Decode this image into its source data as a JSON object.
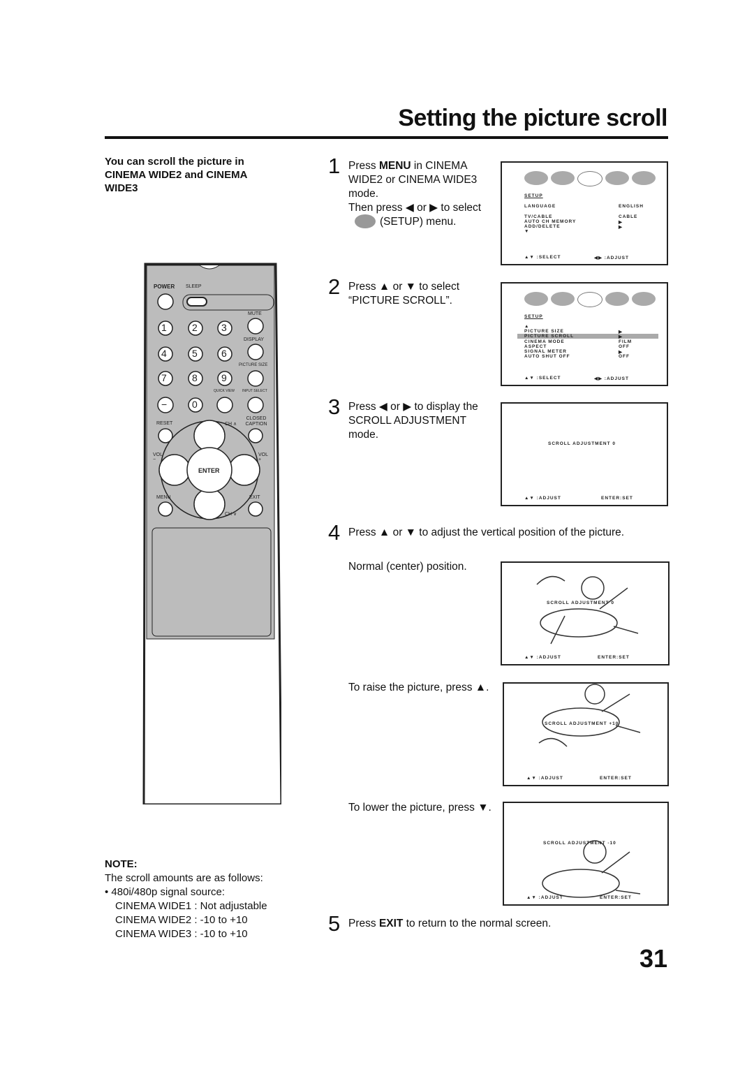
{
  "title": "Setting the picture scroll",
  "intro": "You can scroll the picture in CINEMA WIDE2 and CINEMA WIDE3",
  "steps": [
    {
      "num": "1",
      "text_pre": "Press ",
      "bold": "MENU",
      "text_post": " in CINEMA WIDE2 or CINEMA WIDE3 mode.",
      "line2": "Then press ◀ or ▶ to select",
      "line3": "(SETUP) menu."
    },
    {
      "num": "2",
      "text": "Press ▲ or ▼ to select “PICTURE SCROLL”."
    },
    {
      "num": "3",
      "text": "Press ◀ or ▶ to display the SCROLL ADJUSTMENT mode."
    },
    {
      "num": "4",
      "text": "Press ▲ or ▼ to adjust the vertical position of the picture."
    },
    {
      "num": "5",
      "text_pre": "Press ",
      "bold": "EXIT",
      "text_post": " to return to the normal screen."
    }
  ],
  "captions": {
    "normal": "Normal (center) position.",
    "raise": "To raise the picture, press ▲.",
    "lower": "To lower the picture, press ▼."
  },
  "osd1": {
    "heading": "SETUP",
    "rows": [
      [
        "LANGUAGE",
        "ENGLISH"
      ],
      [
        "TV/CABLE",
        "CABLE"
      ],
      [
        "AUTO CH MEMORY",
        "▶"
      ],
      [
        "ADD/DELETE",
        "▶"
      ]
    ],
    "more": "▼",
    "select": "▲▼ :SELECT",
    "adjust": "◀▶ :ADJUST"
  },
  "osd2": {
    "heading": "SETUP",
    "up": "▲",
    "rows": [
      [
        "PICTURE SIZE",
        "▶"
      ],
      [
        "PICTURE SCROLL",
        "▶"
      ],
      [
        "CINEMA MODE",
        "FILM"
      ],
      [
        "ASPECT",
        "OFF"
      ],
      [
        "SIGNAL METER",
        "▶"
      ],
      [
        "AUTO SHUT OFF",
        "OFF"
      ]
    ],
    "select": "▲▼ :SELECT",
    "adjust": "◀▶ :ADJUST"
  },
  "osd3": {
    "label": "SCROLL ADJUSTMENT  0",
    "adjust": "▲▼ :ADJUST",
    "set": "ENTER:SET"
  },
  "osd4": {
    "label": "SCROLL ADJUSTMENT  0",
    "adjust": "▲▼ :ADJUST",
    "set": "ENTER:SET"
  },
  "osd5": {
    "label": "SCROLL ADJUSTMENT  +10",
    "adjust": "▲▼ :ADJUST",
    "set": "ENTER:SET"
  },
  "osd6": {
    "label": "SCROLL ADJUSTMENT  -10",
    "adjust": "▲▼ :ADJUST",
    "set": "ENTER:SET"
  },
  "remote": {
    "power": "POWER",
    "sleep": "SLEEP",
    "mute": "MUTE",
    "display": "DISPLAY",
    "picture_size": "PICTURE SIZE",
    "quick_view": "QUICK VIEW",
    "input_select": "INPUT SELECT",
    "reset": "RESET",
    "ch_up": "CH ∧",
    "closed_caption": "CLOSED CAPTION",
    "vol_minus": "VOL −",
    "vol_plus": "VOL +",
    "enter": "ENTER",
    "menu": "MENU",
    "exit": "EXIT",
    "ch_down": "CH ∨",
    "digits": [
      "1",
      "2",
      "3",
      "4",
      "5",
      "6",
      "7",
      "8",
      "9",
      "−",
      "0"
    ]
  },
  "note": {
    "heading": "NOTE:",
    "line1": "The scroll amounts are as follows:",
    "bullet": "480i/480p signal source:",
    "items": [
      "CINEMA WIDE1 : Not adjustable",
      "CINEMA WIDE2 : -10 to +10",
      "CINEMA WIDE3 : -10 to +10"
    ]
  },
  "page_number": "31"
}
